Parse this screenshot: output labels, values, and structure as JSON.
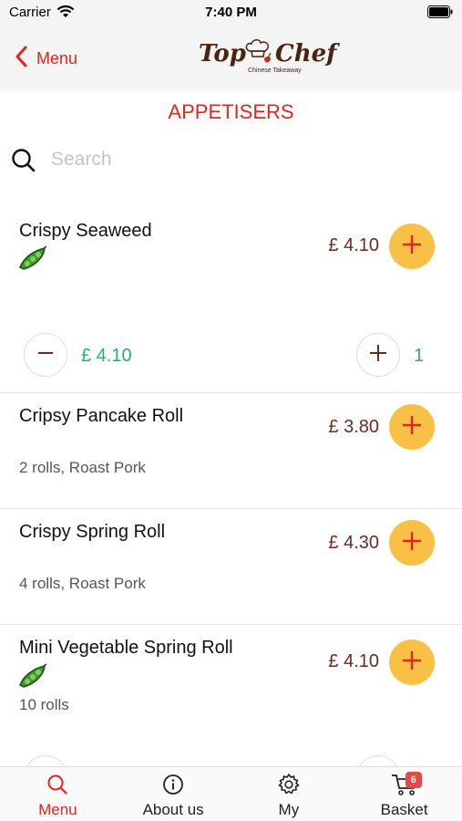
{
  "status_bar": {
    "carrier": "Carrier",
    "time": "7:40 PM"
  },
  "nav": {
    "back_label": "Menu",
    "logo_left": "Top",
    "logo_right": "Chef",
    "logo_subtitle": "Chinese Takeaway"
  },
  "category": {
    "title": "APPETISERS"
  },
  "search": {
    "placeholder": "Search",
    "value": ""
  },
  "items": [
    {
      "name": "Crispy Seaweed",
      "price": "£ 4.10",
      "vegetarian": true,
      "description": "",
      "in_basket": {
        "subtotal": "£ 4.10",
        "quantity": "1"
      }
    },
    {
      "name": "Cripsy Pancake Roll",
      "price": "£ 3.80",
      "vegetarian": false,
      "description": "2 rolls, Roast Pork"
    },
    {
      "name": "Crispy Spring Roll",
      "price": "£ 4.30",
      "vegetarian": false,
      "description": "4 rolls, Roast Pork"
    },
    {
      "name": "Mini Vegetable Spring Roll",
      "price": "£ 4.10",
      "vegetarian": true,
      "description": "10 rolls"
    }
  ],
  "tabs": [
    {
      "label": "Menu",
      "icon": "search-icon",
      "active": true
    },
    {
      "label": "About us",
      "icon": "info-icon",
      "active": false
    },
    {
      "label": "My",
      "icon": "gear-icon",
      "active": false
    },
    {
      "label": "Basket",
      "icon": "cart-icon",
      "active": false,
      "badge": "6"
    }
  ],
  "colors": {
    "accent": "#e0251c",
    "price": "#6e2a1f",
    "add_button": "#f8c146",
    "quantity": "#27b06e",
    "badge": "#e24a45"
  }
}
